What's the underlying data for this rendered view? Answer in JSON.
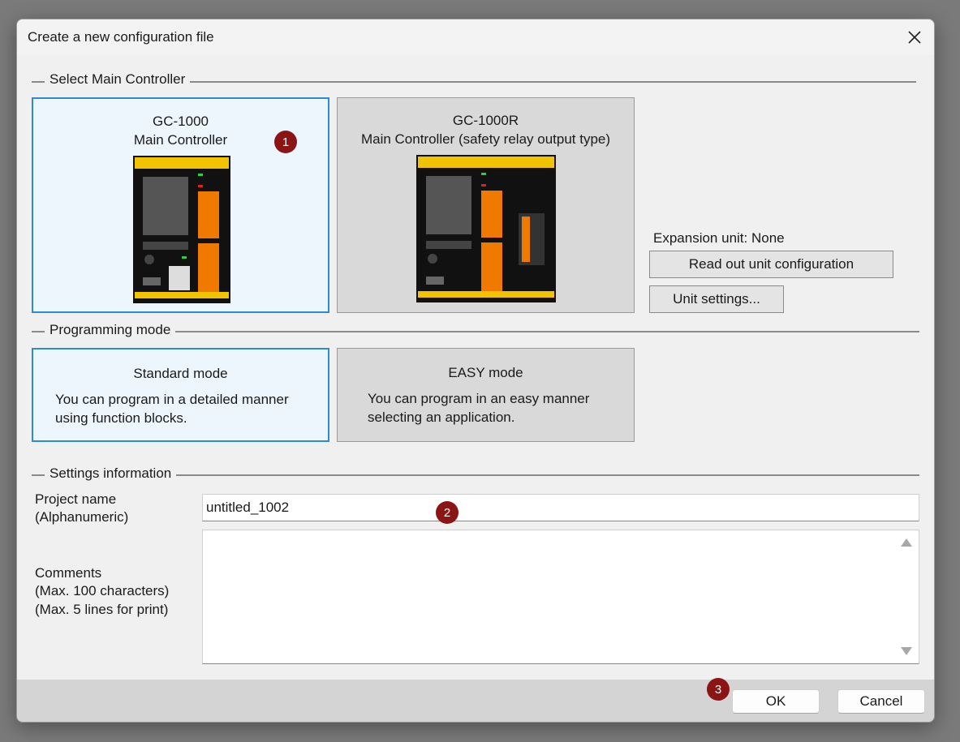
{
  "dialog": {
    "title": "Create a new configuration file"
  },
  "controller_section": {
    "label": "Select Main Controller",
    "cards": [
      {
        "model": "GC-1000",
        "desc": "Main Controller"
      },
      {
        "model": "GC-1000R",
        "desc": "Main Controller (safety relay output type)"
      }
    ],
    "expansion_label": "Expansion unit: None",
    "read_config_label": "Read out unit configuration",
    "unit_settings_label": "Unit settings..."
  },
  "mode_section": {
    "label": "Programming mode",
    "modes": [
      {
        "name": "Standard mode",
        "line1": "You can program in a detailed manner",
        "line2": "using function blocks."
      },
      {
        "name": "EASY mode",
        "line1": "You can program in an easy manner",
        "line2": "selecting an application."
      }
    ]
  },
  "settings_section": {
    "label": "Settings information",
    "project_name_label1": "Project name",
    "project_name_label2": "(Alphanumeric)",
    "project_name_value": "untitled_1002",
    "comments_label1": "Comments",
    "comments_label2": "(Max. 100 characters)",
    "comments_label3": "(Max. 5 lines for print)",
    "comments_value": ""
  },
  "footer": {
    "ok_label": "OK",
    "cancel_label": "Cancel"
  },
  "markers": [
    "1",
    "2",
    "3"
  ],
  "colors": {
    "accent": "#2c8ad6",
    "marker": "#8b1515",
    "brand_yellow": "#f2c300"
  }
}
